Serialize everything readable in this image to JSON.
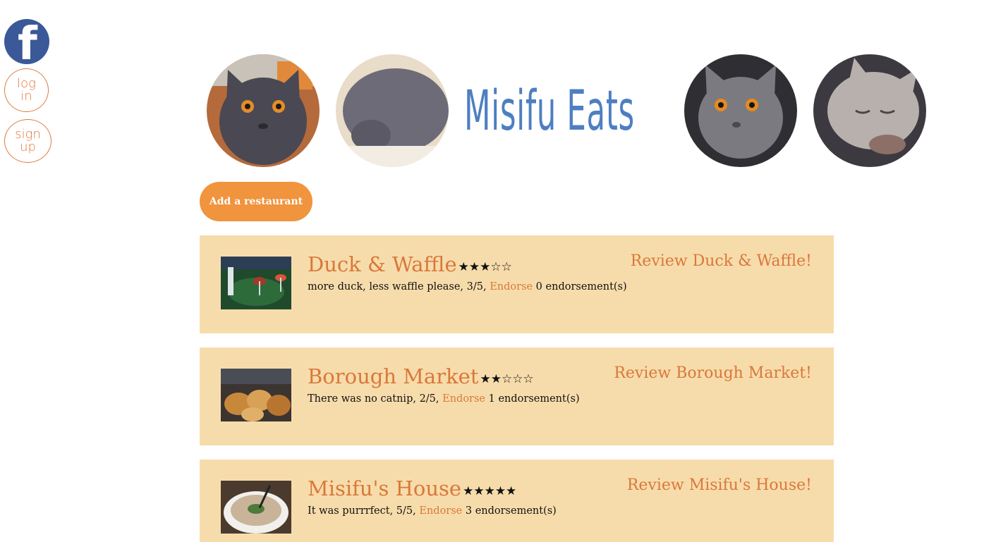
{
  "sidebar": {
    "facebook_icon": "facebook-icon",
    "login_label": "log\nin",
    "signup_label": "sign\nup"
  },
  "header": {
    "title": "Misifu Eats"
  },
  "add_button_label": "Add a restaurant",
  "colors": {
    "accent": "#d9783b",
    "button": "#f0943d",
    "card_bg": "#f7dcab",
    "title": "#4d7fc1",
    "facebook": "#3b5998"
  },
  "restaurants": [
    {
      "name": "Duck & Waffle",
      "stars": "★★★☆☆",
      "rating": 3,
      "review_text": "more duck, less waffle please, 3/5, ",
      "endorse_label": "Endorse",
      "endorsements": " 0 endorsement(s)",
      "review_link": "Review Duck & Waffle!"
    },
    {
      "name": "Borough Market",
      "stars": "★★☆☆☆",
      "rating": 2,
      "review_text": "There was no catnip, 2/5, ",
      "endorse_label": "Endorse",
      "endorsements": " 1 endorsement(s)",
      "review_link": "Review Borough Market!"
    },
    {
      "name": "Misifu's House",
      "stars": "★★★★★",
      "rating": 5,
      "review_text": "It was purrrfect, 5/5, ",
      "endorse_label": "Endorse",
      "endorsements": " 3 endorsement(s)",
      "review_link": "Review Misifu's House!"
    }
  ]
}
